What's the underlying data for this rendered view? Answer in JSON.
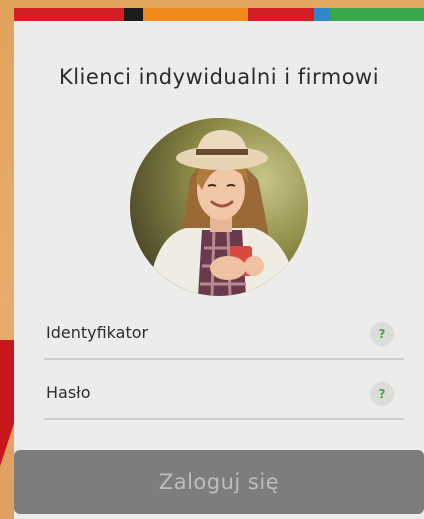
{
  "stripe_colors": [
    "#d32027",
    "#d32027",
    "#1c1c1c",
    "#ef8a1b",
    "#ef8a1b",
    "#d32027",
    "#2f86c8",
    "#3aa84a"
  ],
  "title": "Klienci indywidualni i firmowi",
  "login_field": {
    "label": "Identyfikator",
    "help": "?"
  },
  "password_field": {
    "label": "Hasło",
    "help": "?"
  },
  "submit_label": "Zaloguj się"
}
